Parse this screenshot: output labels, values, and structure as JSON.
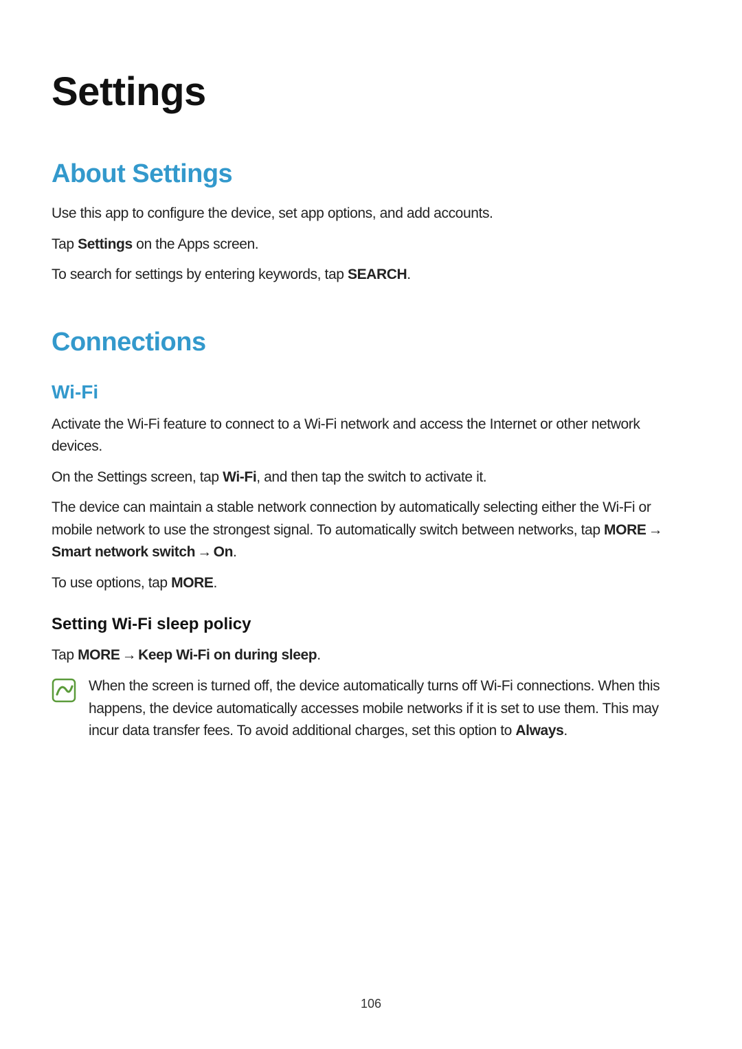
{
  "page": {
    "title": "Settings",
    "number": "106"
  },
  "about": {
    "heading": "About Settings",
    "p1": "Use this app to configure the device, set app options, and add accounts.",
    "p2_pre": "Tap ",
    "p2_bold": "Settings",
    "p2_post": " on the Apps screen.",
    "p3_pre": "To search for settings by entering keywords, tap ",
    "p3_bold": "SEARCH",
    "p3_post": "."
  },
  "connections": {
    "heading": "Connections"
  },
  "wifi": {
    "heading": "Wi-Fi",
    "p1": "Activate the Wi-Fi feature to connect to a Wi-Fi network and access the Internet or other network devices.",
    "p2_pre": "On the Settings screen, tap ",
    "p2_bold": "Wi-Fi",
    "p2_post": ", and then tap the switch to activate it.",
    "p3_pre": "The device can maintain a stable network connection by automatically selecting either the Wi-Fi or mobile network to use the strongest signal. To automatically switch between networks, tap ",
    "p3_b1": "MORE",
    "p3_b2": "Smart network switch",
    "p3_b3": "On",
    "p3_post": ".",
    "p4_pre": "To use options, tap ",
    "p4_bold": "MORE",
    "p4_post": "."
  },
  "sleep": {
    "heading": "Setting Wi-Fi sleep policy",
    "p1_pre": "Tap ",
    "p1_b1": "MORE",
    "p1_b2": "Keep Wi-Fi on during sleep",
    "p1_post": "."
  },
  "note": {
    "text_pre": "When the screen is turned off, the device automatically turns off Wi-Fi connections. When this happens, the device automatically accesses mobile networks if it is set to use them. This may incur data transfer fees. To avoid additional charges, set this option to ",
    "text_bold": "Always",
    "text_post": "."
  },
  "arrow": "→"
}
